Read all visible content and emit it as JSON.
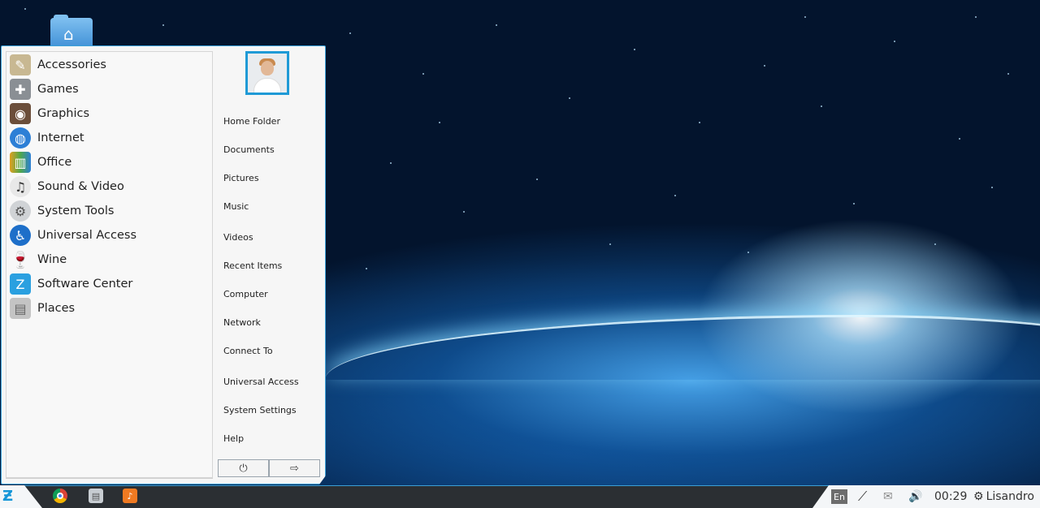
{
  "menu": {
    "categories": [
      {
        "label": "Accessories",
        "icon": "accessories-icon",
        "color": "#b9a98a"
      },
      {
        "label": "Games",
        "icon": "gamepad-icon",
        "color": "#8a8f94"
      },
      {
        "label": "Graphics",
        "icon": "graphics-icon",
        "color": "#6b4e3a"
      },
      {
        "label": "Internet",
        "icon": "globe-icon",
        "color": "#2d7fd6"
      },
      {
        "label": "Office",
        "icon": "office-icon",
        "color": "#4fa84a"
      },
      {
        "label": "Sound & Video",
        "icon": "headphones-icon",
        "color": "#3a3a3a"
      },
      {
        "label": "System Tools",
        "icon": "gears-icon",
        "color": "#9aa0a6"
      },
      {
        "label": "Universal Access",
        "icon": "accessibility-icon",
        "color": "#1e6fc9"
      },
      {
        "label": "Wine",
        "icon": "wine-glass-icon",
        "color": "#8b1a1a"
      },
      {
        "label": "Software Center",
        "icon": "software-center-icon",
        "color": "#2aa0e0"
      },
      {
        "label": "Places",
        "icon": "drive-icon",
        "color": "#b0b0b0"
      }
    ],
    "places": [
      "Home Folder",
      "Documents",
      "Pictures",
      "Music",
      "Videos",
      "Recent Items",
      "Computer",
      "Network",
      "Connect To",
      "Universal Access",
      "System Settings",
      "Help"
    ],
    "buttons": {
      "shutdown_icon": "⏻",
      "logout_icon": "⇨"
    }
  },
  "taskbar": {
    "language": "En",
    "clock": "00:29",
    "user": "Lisandro",
    "apps": [
      "chrome-icon",
      "file-manager-icon",
      "music-player-icon"
    ]
  }
}
